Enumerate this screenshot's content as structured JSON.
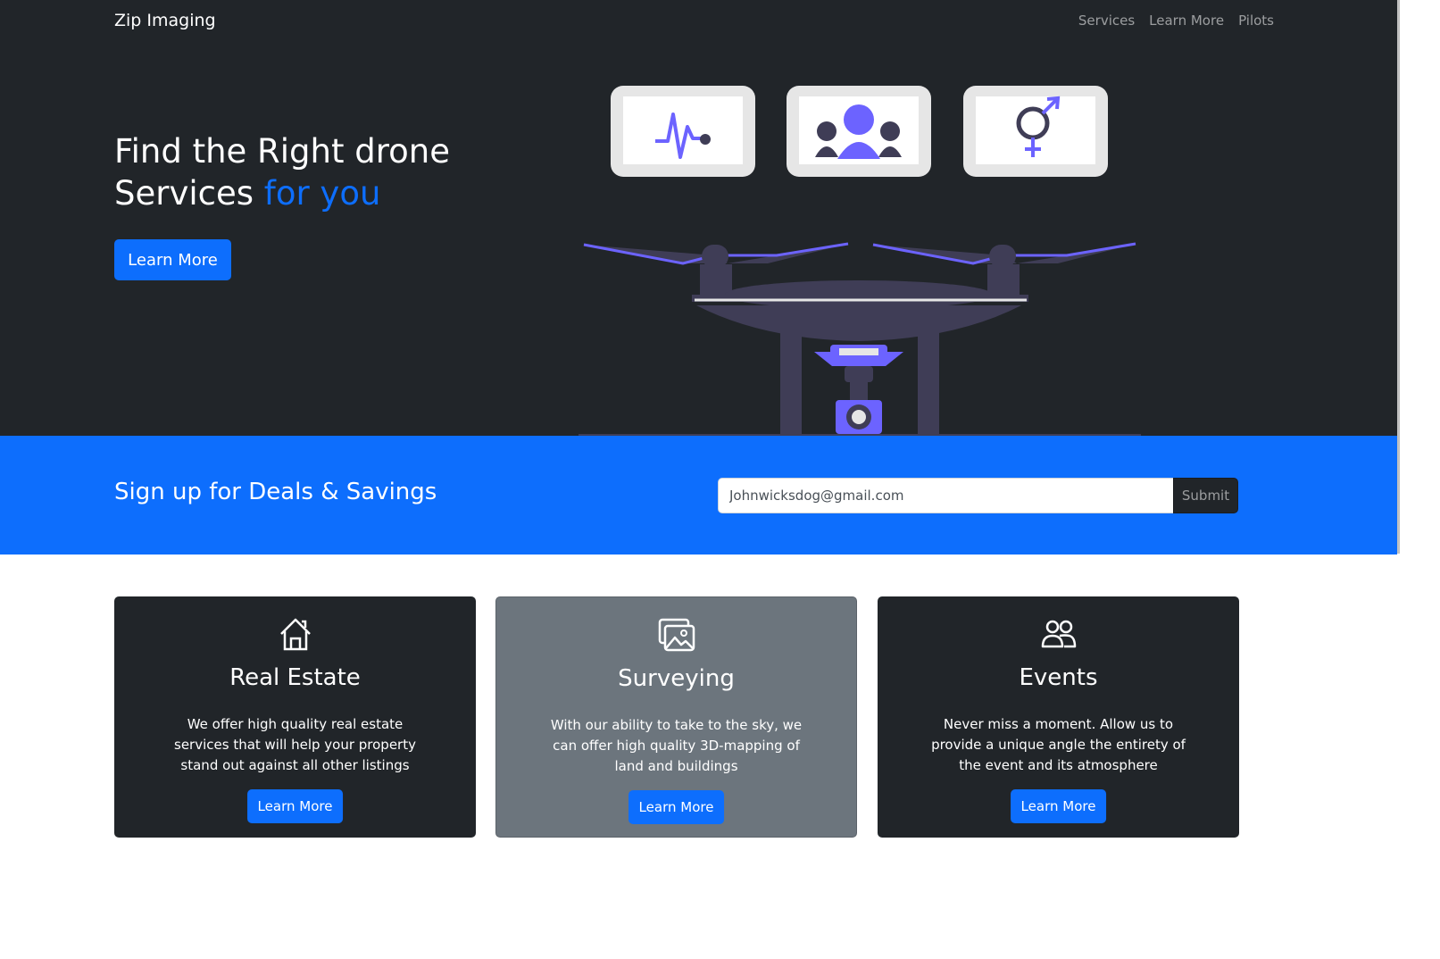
{
  "navbar": {
    "brand": "Zip Imaging",
    "links": [
      "Services",
      "Learn More",
      "Pilots"
    ]
  },
  "hero": {
    "title_part1": "Find the Right drone Services ",
    "title_accent": "for you",
    "button_label": "Learn More",
    "illustration_icons": [
      "heartbeat-icon",
      "people-icon",
      "gender-icon"
    ]
  },
  "signup": {
    "title": "Sign up for Deals & Savings",
    "email_value": "Johnwicksdog@gmail.com",
    "submit_label": "Submit"
  },
  "cards": [
    {
      "icon": "house-icon",
      "title": "Real Estate",
      "text": "We offer high quality real estate services that will help your property stand out against all other listings",
      "button": "Learn More"
    },
    {
      "icon": "images-icon",
      "title": "Surveying",
      "text": "With our ability to take to the sky, we can offer high quality 3D-mapping of land and buildings",
      "button": "Learn More"
    },
    {
      "icon": "people-icon",
      "title": "Events",
      "text": "Never miss a moment. Allow us to provide a unique angle the entirety of the event and its atmosphere",
      "button": "Learn More"
    }
  ],
  "colors": {
    "dark": "#212529",
    "primary": "#0d6efd",
    "secondary": "#6c757d",
    "illustration_purple": "#6c63ff",
    "illustration_body": "#3f3d56"
  }
}
